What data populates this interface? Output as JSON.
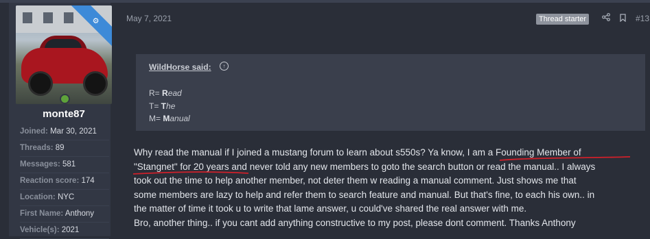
{
  "user": {
    "username": "monte87",
    "info": [
      {
        "label": "Joined:",
        "value": "Mar 30, 2021"
      },
      {
        "label": "Threads:",
        "value": "89"
      },
      {
        "label": "Messages:",
        "value": "581"
      },
      {
        "label": "Reaction score:",
        "value": "174"
      },
      {
        "label": "Location:",
        "value": "NYC"
      },
      {
        "label": "First Name:",
        "value": "Anthony"
      },
      {
        "label": "Vehicle(s):",
        "value": "2021"
      }
    ],
    "avatar_icon": "gears-icon",
    "online_status_color": "#5ea33a"
  },
  "post": {
    "date": "May 7, 2021",
    "badge": "Thread starter",
    "number": "#13",
    "quote": {
      "author": "WildHorse said:",
      "lines": [
        {
          "letter": "R= ",
          "bold": "R",
          "rest": "ead"
        },
        {
          "letter": "T= ",
          "bold": "T",
          "rest": "he"
        },
        {
          "letter": "M= ",
          "bold": "M",
          "rest": "anual"
        }
      ]
    },
    "body_lines": [
      "Why read the manual if I joined a mustang forum to learn about s550s? Ya know, I am a Founding Member of",
      "\"Stangnet\" for 20 years and never told any new members to goto the search button or read the manual.. I always",
      "took out the time to help another member, not deter them w reading a manual comment. Just shows me that",
      "some members are lazy to help and refer them to search feature and manual. But that's fine, to each his own.. in",
      "the matter of time it took u to write that lame answer, u could've shared the real answer with me.",
      "Bro, another thing.. if you cant add anything constructive to my post, please dont comment. Thanks Anthony"
    ]
  },
  "colors": {
    "background": "#2a2e38",
    "sidebar": "#323744",
    "quote_bg": "#3a3f4c",
    "annotation_red": "#d0202a",
    "ribbon": "#3d8ad8"
  }
}
